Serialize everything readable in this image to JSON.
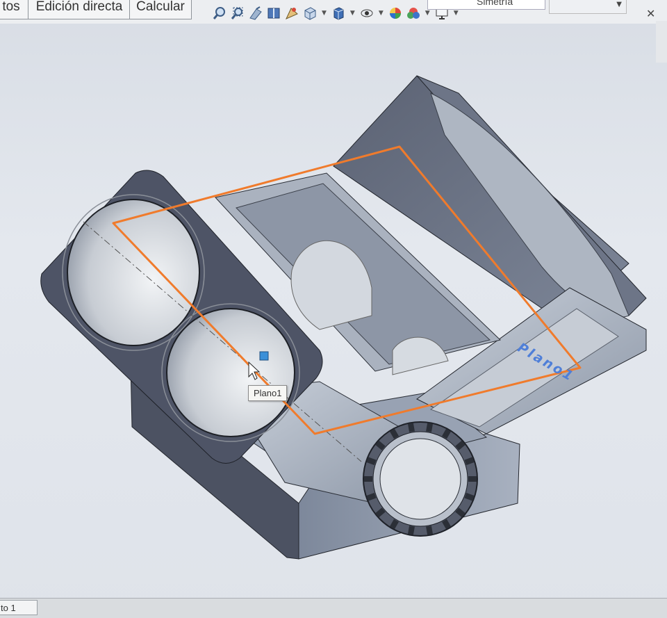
{
  "toolbar": {
    "tabs": [
      "tos",
      "Edición directa",
      "Calcular"
    ],
    "config_text": "Simetría",
    "heads_up_icons": [
      "zoom-to-fit-icon",
      "zoom-to-area-icon",
      "previous-view-icon",
      "section-view-icon",
      "dynamic-annotation-icon",
      "view-orientation-icon",
      "display-style-icon",
      "hide-show-items-icon",
      "edit-appearance-icon",
      "apply-scene-icon",
      "view-settings-icon"
    ]
  },
  "viewport": {
    "tooltip": "Plano1",
    "plane_label": "Plano1"
  },
  "statusbar": {
    "tab": "to 1"
  },
  "colors": {
    "plane": "#f07b2c",
    "plane_label": "#4f7fd8",
    "part": "#7c8598"
  }
}
